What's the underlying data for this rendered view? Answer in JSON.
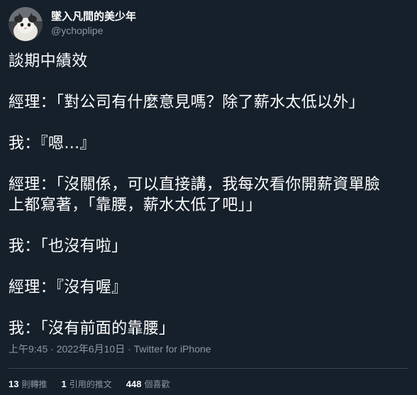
{
  "author": {
    "display_name": "墜入凡間的美少年",
    "username": "@ychoplipe",
    "avatar_icon": "cat-avatar"
  },
  "tweet": {
    "lines": [
      "談期中績效",
      "",
      "經理：「對公司有什麼意見嗎？除了薪水太低以外」",
      "",
      "我：『嗯…』",
      "",
      "經理：「沒關係，可以直接講，我每次看你開薪資單臉",
      "上都寫著，「靠腰，薪水太低了吧」」",
      "",
      "我：「也沒有啦」",
      "",
      "經理：『沒有喔』",
      "",
      "我：「沒有前面的靠腰」"
    ]
  },
  "meta": {
    "timestamp": "上午9:45 · 2022年6月10日 · Twitter for iPhone"
  },
  "stats": {
    "retweets_count": "13",
    "retweets_label": "則轉推",
    "quotes_count": "1",
    "quotes_label": "引用的推文",
    "likes_count": "448",
    "likes_label": "個喜歡"
  },
  "colors": {
    "background": "#15202b",
    "text": "#ffffff",
    "secondary": "#8b98a5",
    "divider": "#38444d"
  }
}
